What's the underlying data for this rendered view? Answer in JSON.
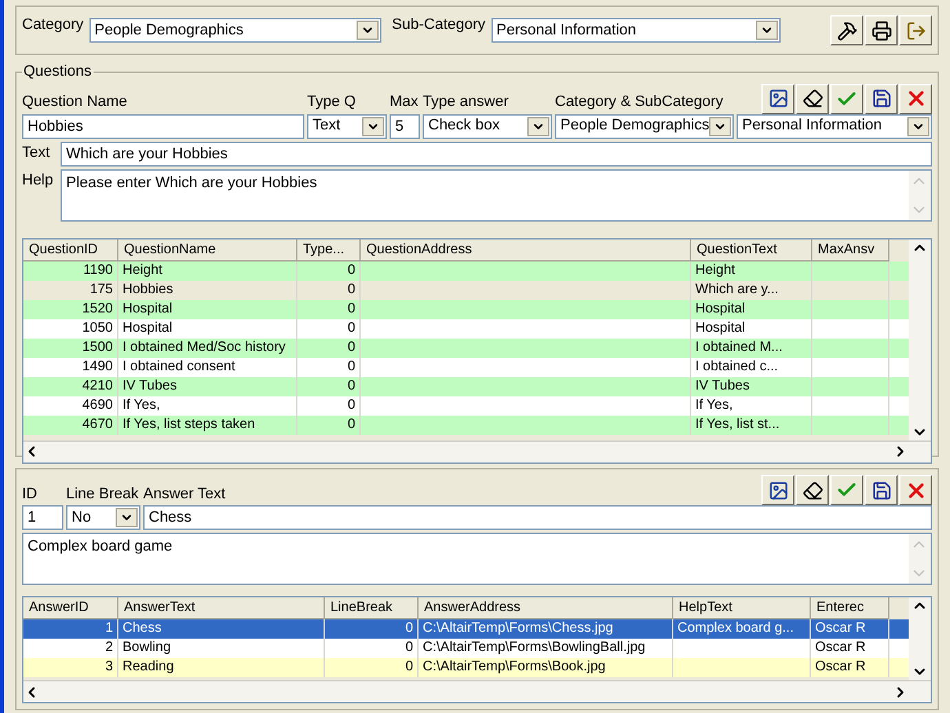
{
  "filter": {
    "category_label": "Category",
    "category": "People Demographics",
    "subcategory_label": "Sub-Category",
    "subcategory": "Personal Information"
  },
  "questions": {
    "title": "Questions",
    "labels": {
      "name": "Question Name",
      "type_q": "Type Q",
      "max": "Max",
      "type_answer": "Type answer",
      "category": "Category & SubCategory",
      "text": "Text",
      "help": "Help"
    },
    "values": {
      "name": "Hobbies",
      "type_q": "Text",
      "max": "5",
      "type_answer": "Check box",
      "category": "People Demographics",
      "subcategory": "Personal Information",
      "text": "Which are your Hobbies",
      "help": "Please enter Which are your Hobbies"
    },
    "table": {
      "columns": [
        "QuestionID",
        "QuestionName",
        "Type...",
        "QuestionAddress",
        "QuestionText",
        "MaxAnsv"
      ],
      "rows": [
        {
          "cells": [
            "1190",
            "Height",
            "0",
            "",
            "Height",
            ""
          ],
          "selected": false
        },
        {
          "cells": [
            "175",
            "Hobbies",
            "0",
            "",
            "Which are y...",
            ""
          ],
          "selected": true
        },
        {
          "cells": [
            "1520",
            "Hospital",
            "0",
            "",
            "Hospital",
            ""
          ],
          "selected": false
        },
        {
          "cells": [
            "1050",
            "Hospital",
            "0",
            "",
            "Hospital",
            ""
          ],
          "selected": false
        },
        {
          "cells": [
            "1500",
            "I obtained Med/Soc history",
            "0",
            "",
            "I obtained M...",
            ""
          ],
          "selected": false
        },
        {
          "cells": [
            "1490",
            "I obtained consent",
            "0",
            "",
            "I obtained c...",
            ""
          ],
          "selected": false
        },
        {
          "cells": [
            "4210",
            "IV Tubes",
            "0",
            "",
            "IV Tubes",
            ""
          ],
          "selected": false
        },
        {
          "cells": [
            "4690",
            "If Yes,",
            "0",
            "",
            "If Yes,",
            ""
          ],
          "selected": false
        },
        {
          "cells": [
            "4670",
            "If Yes, list steps taken",
            "0",
            "",
            "If Yes, list st...",
            ""
          ],
          "selected": false
        }
      ]
    }
  },
  "answers": {
    "labels": {
      "id": "ID",
      "line_break": "Line Break",
      "answer_text": "Answer Text"
    },
    "values": {
      "id": "1",
      "line_break": "No",
      "answer_text": "Chess",
      "help": "Complex board game"
    },
    "table": {
      "columns": [
        "AnswerID",
        "AnswerText",
        "LineBreak",
        "AnswerAddress",
        "HelpText",
        "Enterec"
      ],
      "rows": [
        {
          "cells": [
            "1",
            "Chess",
            "0",
            "C:\\AltairTemp\\Forms\\Chess.jpg",
            "Complex board g...",
            "Oscar R"
          ],
          "selected": true
        },
        {
          "cells": [
            "2",
            "Bowling",
            "0",
            "C:\\AltairTemp\\Forms\\BowlingBall.jpg",
            "",
            "Oscar R"
          ],
          "selected": false
        },
        {
          "cells": [
            "3",
            "Reading",
            "0",
            "C:\\AltairTemp\\Forms\\Book.jpg",
            "",
            "Oscar R"
          ],
          "selected": false
        }
      ]
    }
  }
}
